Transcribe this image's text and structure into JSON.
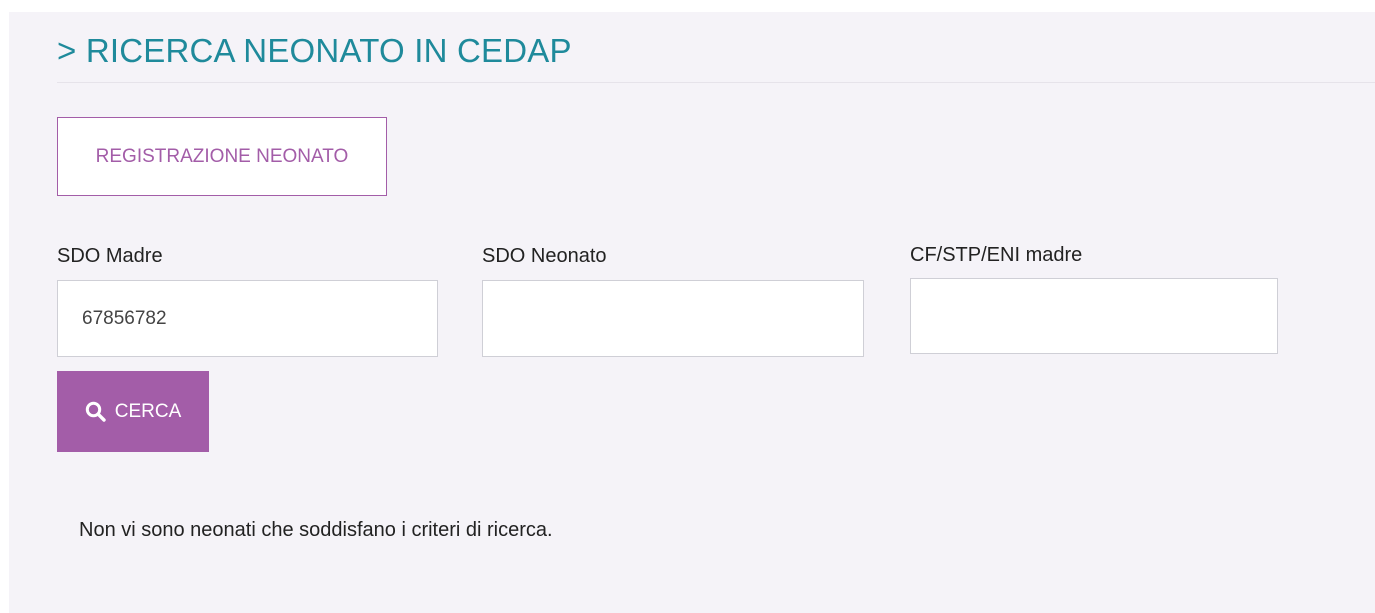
{
  "header": {
    "title": "> RICERCA NEONATO IN CEDAP"
  },
  "actions": {
    "register_newborn_label": "REGISTRAZIONE NEONATO"
  },
  "search_form": {
    "fields": [
      {
        "label": "SDO Madre",
        "value": "67856782",
        "placeholder": ""
      },
      {
        "label": "SDO Neonato",
        "value": "",
        "placeholder": ""
      },
      {
        "label": "CF/STP/ENI madre",
        "value": "",
        "placeholder": ""
      }
    ],
    "search_button_label": "CERCA",
    "search_icon": "search-icon"
  },
  "results": {
    "message": "Non vi sono neonati che soddisfano i criteri di ricerca."
  },
  "colors": {
    "title": "#1f8a9b",
    "accent": "#a35da8",
    "panel_background": "#f5f3f8"
  }
}
